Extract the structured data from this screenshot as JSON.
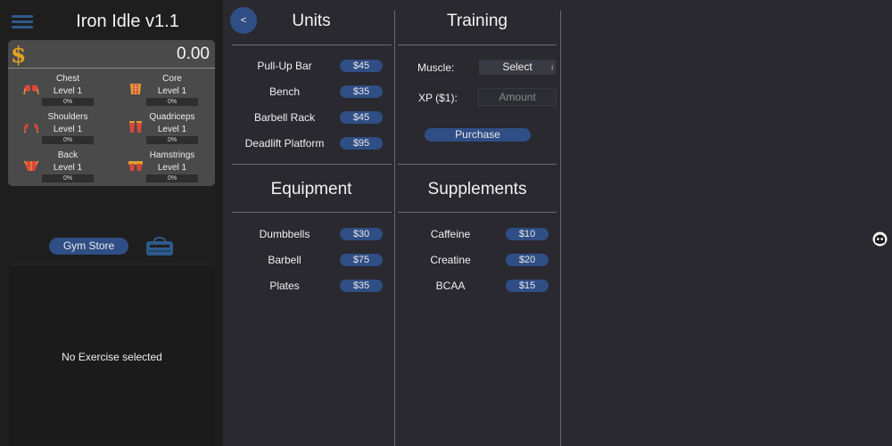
{
  "sidebar": {
    "title": "Iron Idle v1.1",
    "money": "0.00",
    "currency_symbol": "$",
    "muscles": [
      {
        "name": "Chest",
        "level": "Level 1",
        "progress": "0%",
        "icon": "chest-icon"
      },
      {
        "name": "Core",
        "level": "Level 1",
        "progress": "0%",
        "icon": "core-icon"
      },
      {
        "name": "Shoulders",
        "level": "Level 1",
        "progress": "0%",
        "icon": "shoulders-icon"
      },
      {
        "name": "Quadriceps",
        "level": "Level 1",
        "progress": "0%",
        "icon": "quadriceps-icon"
      },
      {
        "name": "Back",
        "level": "Level 1",
        "progress": "0%",
        "icon": "back-icon"
      },
      {
        "name": "Hamstrings",
        "level": "Level 1",
        "progress": "0%",
        "icon": "hamstrings-icon"
      }
    ],
    "gym_store_label": "Gym Store",
    "no_exercise_text": "No Exercise selected"
  },
  "units": {
    "back_label": "<",
    "title": "Units",
    "items": [
      {
        "name": "Pull-Up Bar",
        "price": "$45"
      },
      {
        "name": "Bench",
        "price": "$35"
      },
      {
        "name": "Barbell Rack",
        "price": "$45"
      },
      {
        "name": "Deadlift Platform",
        "price": "$95"
      }
    ]
  },
  "equipment": {
    "title": "Equipment",
    "items": [
      {
        "name": "Dumbbells",
        "price": "$30"
      },
      {
        "name": "Barbell",
        "price": "$75"
      },
      {
        "name": "Plates",
        "price": "$35"
      }
    ]
  },
  "training": {
    "title": "Training",
    "muscle_label": "Muscle:",
    "muscle_select_value": "Select",
    "xp_label": "XP ($1):",
    "xp_placeholder": "Amount",
    "purchase_label": "Purchase"
  },
  "supplements": {
    "title": "Supplements",
    "items": [
      {
        "name": "Caffeine",
        "price": "$10"
      },
      {
        "name": "Creatine",
        "price": "$20"
      },
      {
        "name": "BCAA",
        "price": "$15"
      }
    ]
  },
  "colors": {
    "accent": "#2f4e85",
    "money": "#e3a323",
    "background": "#2a2930",
    "sidebar": "#1e1e1e"
  }
}
